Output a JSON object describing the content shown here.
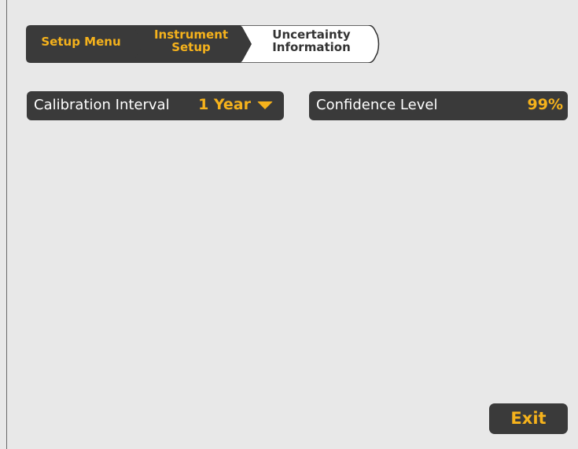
{
  "breadcrumb": {
    "items": [
      {
        "label": "Setup Menu",
        "state": "visited"
      },
      {
        "label": "Instrument\nSetup",
        "state": "visited"
      },
      {
        "label": "Uncertainty\nInformation",
        "state": "current"
      }
    ]
  },
  "settings": {
    "calibration_interval": {
      "label": "Calibration Interval",
      "value": "1 Year"
    },
    "confidence_level": {
      "label": "Confidence Level",
      "value": "99%"
    }
  },
  "exit_label": "Exit",
  "colors": {
    "accent": "#f5b21c",
    "panel": "#3a3a3a",
    "background": "#e8e8e8"
  },
  "icons": {
    "dropdown": "chevron-down-icon"
  }
}
